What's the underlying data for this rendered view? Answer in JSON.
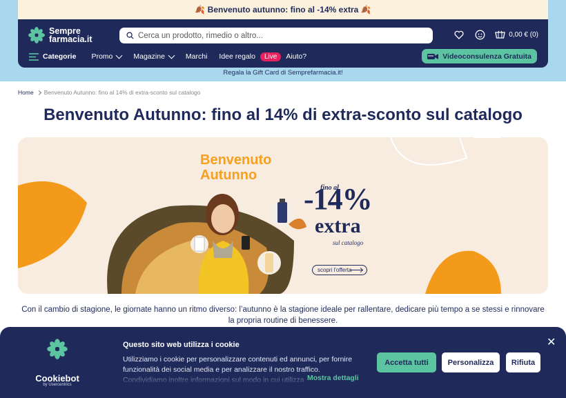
{
  "promo_bar": {
    "text": "🍂 Benvenuto autunno: fino al -14% extra 🍂"
  },
  "header": {
    "logo_line1": "Sempre",
    "logo_line2": "farmacia.it",
    "search_placeholder": "Cerca un prodotto, rimedio o altro...",
    "cart_total": "0,00 € (0)",
    "icons": [
      "heart-icon",
      "user-icon",
      "cart-icon",
      "search-icon",
      "menu-icon"
    ]
  },
  "nav": {
    "categories": "Categorie",
    "items": [
      "Promo",
      "Magazine",
      "Marchi",
      "Idee regalo"
    ],
    "live": "Live",
    "help": "Aiuto?",
    "video_button": "Videoconsulenza Gratuita"
  },
  "giftcard_text": "Regala la Gift Card di Semprefarmacia.it!",
  "breadcrumb": {
    "home": "Home",
    "current": "Benvenuto Autunno: fino al 14% di extra-sconto sul catalogo"
  },
  "page_title": "Benvenuto Autunno: fino al 14% di extra-sconto sul catalogo",
  "banner": {
    "title_line1": "Benvenuto",
    "title_line2": "Autunno",
    "fino_al": "fino al",
    "percent": "-14%",
    "extra": "extra",
    "sul_catalogo": "sul catalogo",
    "cta": "scopri l'offerta"
  },
  "intro_text": "Con il cambio di stagione, le giornate hanno un ritmo diverso: l’autunno è la stagione ideale per rallentare, dedicare più tempo a se stessi e rinnovare la propria routine di benessere.",
  "cookie": {
    "brand": "Cookiebot",
    "brand_sub": "by Usercentrics",
    "title": "Questo sito web utilizza i cookie",
    "body": "Utilizziamo i cookie per personalizzare contenuti ed annunci, per fornire funzionalità dei social media e per analizzare il nostro traffico. Condividiamo inoltre informazioni sul modo in cui utilizza",
    "more": "Mostra dettagli",
    "accept": "Accetta tutti",
    "customize": "Personalizza",
    "reject": "Rifiuta",
    "close": "✕"
  },
  "colors": {
    "navy": "#1f2a5a",
    "mint": "#5cc4a0",
    "orange": "#f5a020",
    "live": "#e7215e",
    "sky": "#a9d8ee",
    "cream": "#fbf1dd"
  }
}
